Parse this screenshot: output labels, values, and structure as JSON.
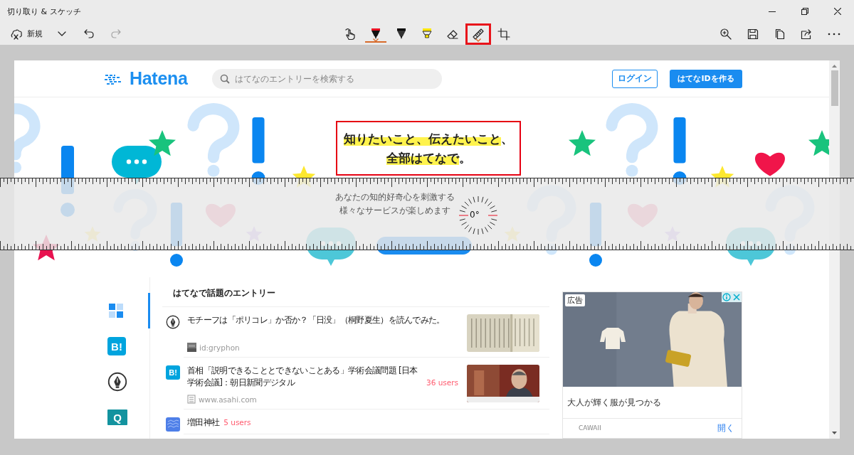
{
  "window": {
    "title": "切り取り & スケッチ"
  },
  "toolbar": {
    "new_label": "新規",
    "history": [
      {
        "kind": "undo",
        "disabled": false
      },
      {
        "kind": "redo",
        "disabled": true
      }
    ],
    "tools": [
      {
        "kind": "touch",
        "selected": false,
        "active": false,
        "highlighted": false
      },
      {
        "kind": "ballpoint",
        "selected": true,
        "active": true,
        "highlighted": false
      },
      {
        "kind": "pencil",
        "selected": false,
        "active": false,
        "highlighted": false
      },
      {
        "kind": "highlighter",
        "selected": false,
        "active": false,
        "highlighted": false
      },
      {
        "kind": "eraser",
        "selected": false,
        "active": false,
        "highlighted": false
      },
      {
        "kind": "ruler",
        "selected": false,
        "active": true,
        "highlighted": true
      },
      {
        "kind": "crop",
        "selected": false,
        "active": false,
        "highlighted": false
      }
    ],
    "actions": [
      {
        "kind": "zoom"
      },
      {
        "kind": "save"
      },
      {
        "kind": "copy"
      },
      {
        "kind": "share"
      },
      {
        "kind": "more"
      }
    ]
  },
  "page": {
    "logo": "Hatena",
    "search": {
      "placeholder": "はてなのエントリーを検索する"
    },
    "buttons": [
      {
        "kind": "outline",
        "label": "ログイン"
      },
      {
        "kind": "primary",
        "label": "はてなIDを作る"
      }
    ],
    "hero": {
      "headline": [
        [
          {
            "text": "知りたいこと、伝えたいこと",
            "marked": true
          },
          {
            "text": "、",
            "marked": false
          }
        ],
        [
          {
            "text": "全部はてなで",
            "marked": true
          },
          {
            "text": "。",
            "marked": false
          }
        ]
      ],
      "subtitle": [
        "あなたの知的好奇心を刺激する",
        "様々なサービスが楽しめます"
      ]
    },
    "nav": [
      {
        "kind": "tiles",
        "selected": true
      },
      {
        "kind": "bookmark",
        "label": "B!",
        "selected": false
      },
      {
        "kind": "blog",
        "selected": false
      },
      {
        "kind": "question",
        "label": "Q",
        "selected": false
      }
    ],
    "section_title": "はてなで話題のエントリー",
    "entries": [
      {
        "icon": {
          "kind": "blog"
        },
        "title": "モチーフは「ポリコレ」か否か？「日没」（桐野夏生）を読んでみた。",
        "source": {
          "kind": "avatar",
          "text": "id:gryphon"
        }
      },
      {
        "icon": {
          "kind": "bookmark",
          "label": "B!"
        },
        "title": "首相「説明できることとできないことある」学術会議問題 [日本学術会議]：朝日新聞デジタル",
        "users": "36 users",
        "source": {
          "kind": "logo",
          "text": "www.asahi.com"
        }
      },
      {
        "icon": {
          "kind": "anond"
        },
        "title": "増田神社",
        "users": "5 users"
      }
    ],
    "ad": {
      "badge": "広告",
      "caption": "大人が輝く服が見つかる",
      "advertiser": "CAWAII",
      "action": "開く"
    }
  },
  "ruler": {
    "angle": "0°"
  }
}
